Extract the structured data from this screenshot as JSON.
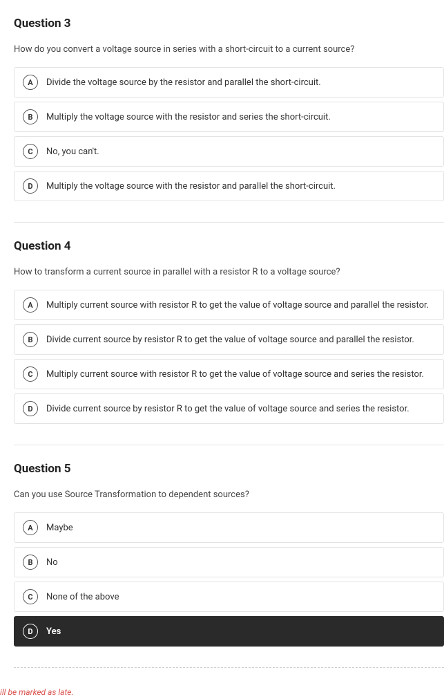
{
  "questions": [
    {
      "title": "Question 3",
      "prompt": "How do you convert a voltage source in series with a short-circuit to a current source?",
      "options": [
        {
          "letter": "A",
          "text": "Divide the voltage source by the resistor and parallel the short-circuit.",
          "selected": false
        },
        {
          "letter": "B",
          "text": "Multiply the voltage source with the resistor and series the short-circuit.",
          "selected": false
        },
        {
          "letter": "C",
          "text": "No, you can't.",
          "selected": false
        },
        {
          "letter": "D",
          "text": "Multiply the voltage source with the resistor and parallel the short-circuit.",
          "selected": false
        }
      ]
    },
    {
      "title": "Question 4",
      "prompt": "How to transform a current source in parallel with a resistor R to a voltage source?",
      "options": [
        {
          "letter": "A",
          "text": "Multiply current source with resistor R to get the value of voltage source and parallel the resistor.",
          "selected": false
        },
        {
          "letter": "B",
          "text": "Divide current source by resistor R to get the value of voltage source and parallel the resistor.",
          "selected": false
        },
        {
          "letter": "C",
          "text": "Multiply current source with resistor R to get the value of voltage source and series the resistor.",
          "selected": false
        },
        {
          "letter": "D",
          "text": "Divide current source by resistor R to get the value of voltage source and series the resistor.",
          "selected": false
        }
      ]
    },
    {
      "title": "Question 5",
      "prompt": "Can you use Source Transformation to dependent sources?",
      "options": [
        {
          "letter": "A",
          "text": "Maybe",
          "selected": false
        },
        {
          "letter": "B",
          "text": "No",
          "selected": false
        },
        {
          "letter": "C",
          "text": "None of the above",
          "selected": false
        },
        {
          "letter": "D",
          "text": "Yes",
          "selected": true
        }
      ]
    }
  ],
  "footer_note": "ill be marked as late."
}
